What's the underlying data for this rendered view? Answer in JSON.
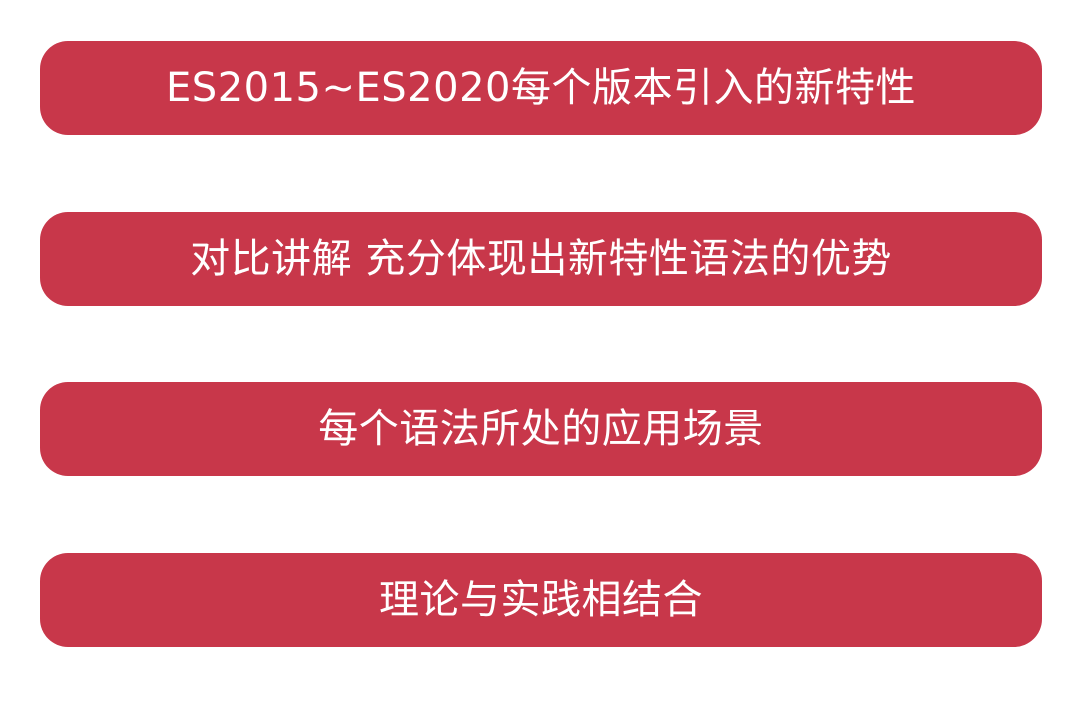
{
  "colors": {
    "pill_background": "#c8374a",
    "pill_text": "#ffffff",
    "page_background": "#ffffff"
  },
  "items": [
    {
      "label": "ES2015~ES2020每个版本引入的新特性"
    },
    {
      "label": "对比讲解 充分体现出新特性语法的优势"
    },
    {
      "label": "每个语法所处的应用场景"
    },
    {
      "label": "理论与实践相结合"
    }
  ]
}
